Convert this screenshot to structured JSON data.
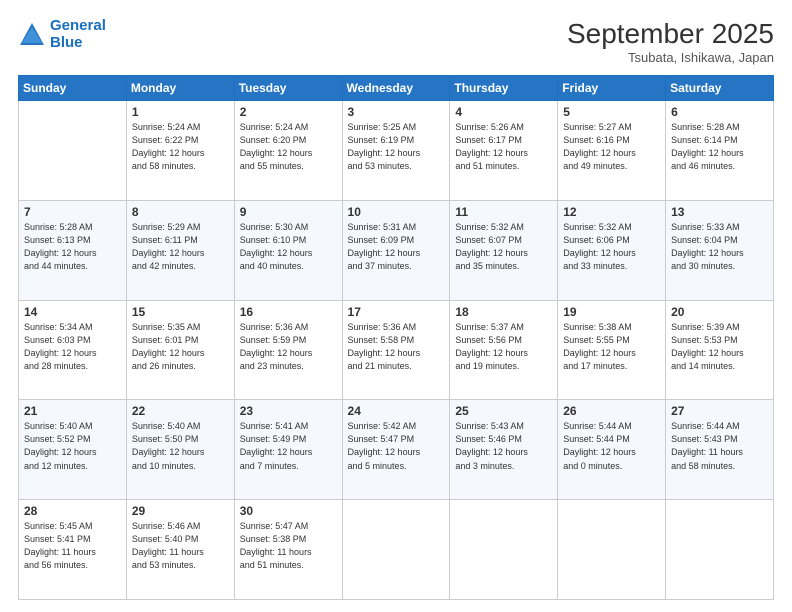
{
  "header": {
    "logo_line1": "General",
    "logo_line2": "Blue",
    "month_year": "September 2025",
    "location": "Tsubata, Ishikawa, Japan"
  },
  "weekdays": [
    "Sunday",
    "Monday",
    "Tuesday",
    "Wednesday",
    "Thursday",
    "Friday",
    "Saturday"
  ],
  "weeks": [
    [
      {
        "day": "",
        "info": ""
      },
      {
        "day": "1",
        "info": "Sunrise: 5:24 AM\nSunset: 6:22 PM\nDaylight: 12 hours\nand 58 minutes."
      },
      {
        "day": "2",
        "info": "Sunrise: 5:24 AM\nSunset: 6:20 PM\nDaylight: 12 hours\nand 55 minutes."
      },
      {
        "day": "3",
        "info": "Sunrise: 5:25 AM\nSunset: 6:19 PM\nDaylight: 12 hours\nand 53 minutes."
      },
      {
        "day": "4",
        "info": "Sunrise: 5:26 AM\nSunset: 6:17 PM\nDaylight: 12 hours\nand 51 minutes."
      },
      {
        "day": "5",
        "info": "Sunrise: 5:27 AM\nSunset: 6:16 PM\nDaylight: 12 hours\nand 49 minutes."
      },
      {
        "day": "6",
        "info": "Sunrise: 5:28 AM\nSunset: 6:14 PM\nDaylight: 12 hours\nand 46 minutes."
      }
    ],
    [
      {
        "day": "7",
        "info": "Sunrise: 5:28 AM\nSunset: 6:13 PM\nDaylight: 12 hours\nand 44 minutes."
      },
      {
        "day": "8",
        "info": "Sunrise: 5:29 AM\nSunset: 6:11 PM\nDaylight: 12 hours\nand 42 minutes."
      },
      {
        "day": "9",
        "info": "Sunrise: 5:30 AM\nSunset: 6:10 PM\nDaylight: 12 hours\nand 40 minutes."
      },
      {
        "day": "10",
        "info": "Sunrise: 5:31 AM\nSunset: 6:09 PM\nDaylight: 12 hours\nand 37 minutes."
      },
      {
        "day": "11",
        "info": "Sunrise: 5:32 AM\nSunset: 6:07 PM\nDaylight: 12 hours\nand 35 minutes."
      },
      {
        "day": "12",
        "info": "Sunrise: 5:32 AM\nSunset: 6:06 PM\nDaylight: 12 hours\nand 33 minutes."
      },
      {
        "day": "13",
        "info": "Sunrise: 5:33 AM\nSunset: 6:04 PM\nDaylight: 12 hours\nand 30 minutes."
      }
    ],
    [
      {
        "day": "14",
        "info": "Sunrise: 5:34 AM\nSunset: 6:03 PM\nDaylight: 12 hours\nand 28 minutes."
      },
      {
        "day": "15",
        "info": "Sunrise: 5:35 AM\nSunset: 6:01 PM\nDaylight: 12 hours\nand 26 minutes."
      },
      {
        "day": "16",
        "info": "Sunrise: 5:36 AM\nSunset: 5:59 PM\nDaylight: 12 hours\nand 23 minutes."
      },
      {
        "day": "17",
        "info": "Sunrise: 5:36 AM\nSunset: 5:58 PM\nDaylight: 12 hours\nand 21 minutes."
      },
      {
        "day": "18",
        "info": "Sunrise: 5:37 AM\nSunset: 5:56 PM\nDaylight: 12 hours\nand 19 minutes."
      },
      {
        "day": "19",
        "info": "Sunrise: 5:38 AM\nSunset: 5:55 PM\nDaylight: 12 hours\nand 17 minutes."
      },
      {
        "day": "20",
        "info": "Sunrise: 5:39 AM\nSunset: 5:53 PM\nDaylight: 12 hours\nand 14 minutes."
      }
    ],
    [
      {
        "day": "21",
        "info": "Sunrise: 5:40 AM\nSunset: 5:52 PM\nDaylight: 12 hours\nand 12 minutes."
      },
      {
        "day": "22",
        "info": "Sunrise: 5:40 AM\nSunset: 5:50 PM\nDaylight: 12 hours\nand 10 minutes."
      },
      {
        "day": "23",
        "info": "Sunrise: 5:41 AM\nSunset: 5:49 PM\nDaylight: 12 hours\nand 7 minutes."
      },
      {
        "day": "24",
        "info": "Sunrise: 5:42 AM\nSunset: 5:47 PM\nDaylight: 12 hours\nand 5 minutes."
      },
      {
        "day": "25",
        "info": "Sunrise: 5:43 AM\nSunset: 5:46 PM\nDaylight: 12 hours\nand 3 minutes."
      },
      {
        "day": "26",
        "info": "Sunrise: 5:44 AM\nSunset: 5:44 PM\nDaylight: 12 hours\nand 0 minutes."
      },
      {
        "day": "27",
        "info": "Sunrise: 5:44 AM\nSunset: 5:43 PM\nDaylight: 11 hours\nand 58 minutes."
      }
    ],
    [
      {
        "day": "28",
        "info": "Sunrise: 5:45 AM\nSunset: 5:41 PM\nDaylight: 11 hours\nand 56 minutes."
      },
      {
        "day": "29",
        "info": "Sunrise: 5:46 AM\nSunset: 5:40 PM\nDaylight: 11 hours\nand 53 minutes."
      },
      {
        "day": "30",
        "info": "Sunrise: 5:47 AM\nSunset: 5:38 PM\nDaylight: 11 hours\nand 51 minutes."
      },
      {
        "day": "",
        "info": ""
      },
      {
        "day": "",
        "info": ""
      },
      {
        "day": "",
        "info": ""
      },
      {
        "day": "",
        "info": ""
      }
    ]
  ]
}
